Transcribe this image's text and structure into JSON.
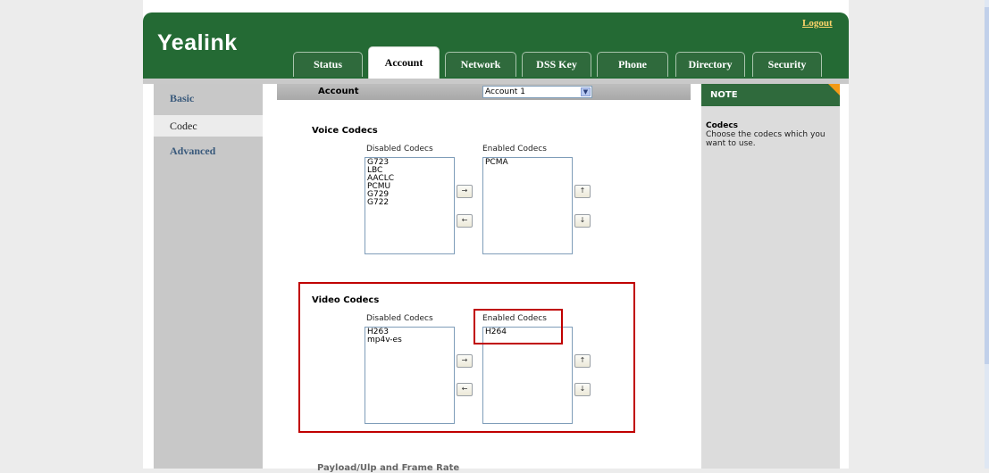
{
  "brand": {
    "logo": "Yealink",
    "logout": "Logout"
  },
  "tabs": [
    "Status",
    "Account",
    "Network",
    "DSS Key",
    "Phone",
    "Directory",
    "Security"
  ],
  "active_tab": "Account",
  "sidebar": {
    "items": [
      "Basic",
      "Codec",
      "Advanced"
    ],
    "active": "Codec"
  },
  "account": {
    "label": "Account",
    "selected": "Account 1"
  },
  "note": {
    "header": "NOTE",
    "title": "Codecs",
    "text": "Choose the codecs which you want to use."
  },
  "voice": {
    "title": "Voice Codecs",
    "disabled_label": "Disabled Codecs",
    "enabled_label": "Enabled Codecs",
    "disabled": [
      "G723",
      "LBC",
      "AACLC",
      "PCMU",
      "G729",
      "G722"
    ],
    "enabled": [
      "PCMA"
    ]
  },
  "video": {
    "title": "Video Codecs",
    "disabled_label": "Disabled Codecs",
    "enabled_label": "Enabled Codecs",
    "disabled": [
      "H263",
      "mp4v-es"
    ],
    "enabled": [
      "H264"
    ]
  },
  "buttons": {
    "right": "→",
    "left": "←",
    "up": "↑",
    "down": "↓",
    "dropdown": "▼"
  },
  "bottom_partial": "Payload/Ulp and Frame Rate",
  "colors": {
    "header_green": "#246a34",
    "logout": "#ffd56b",
    "note_corner": "#f29a16",
    "highlight": "#c00000"
  }
}
